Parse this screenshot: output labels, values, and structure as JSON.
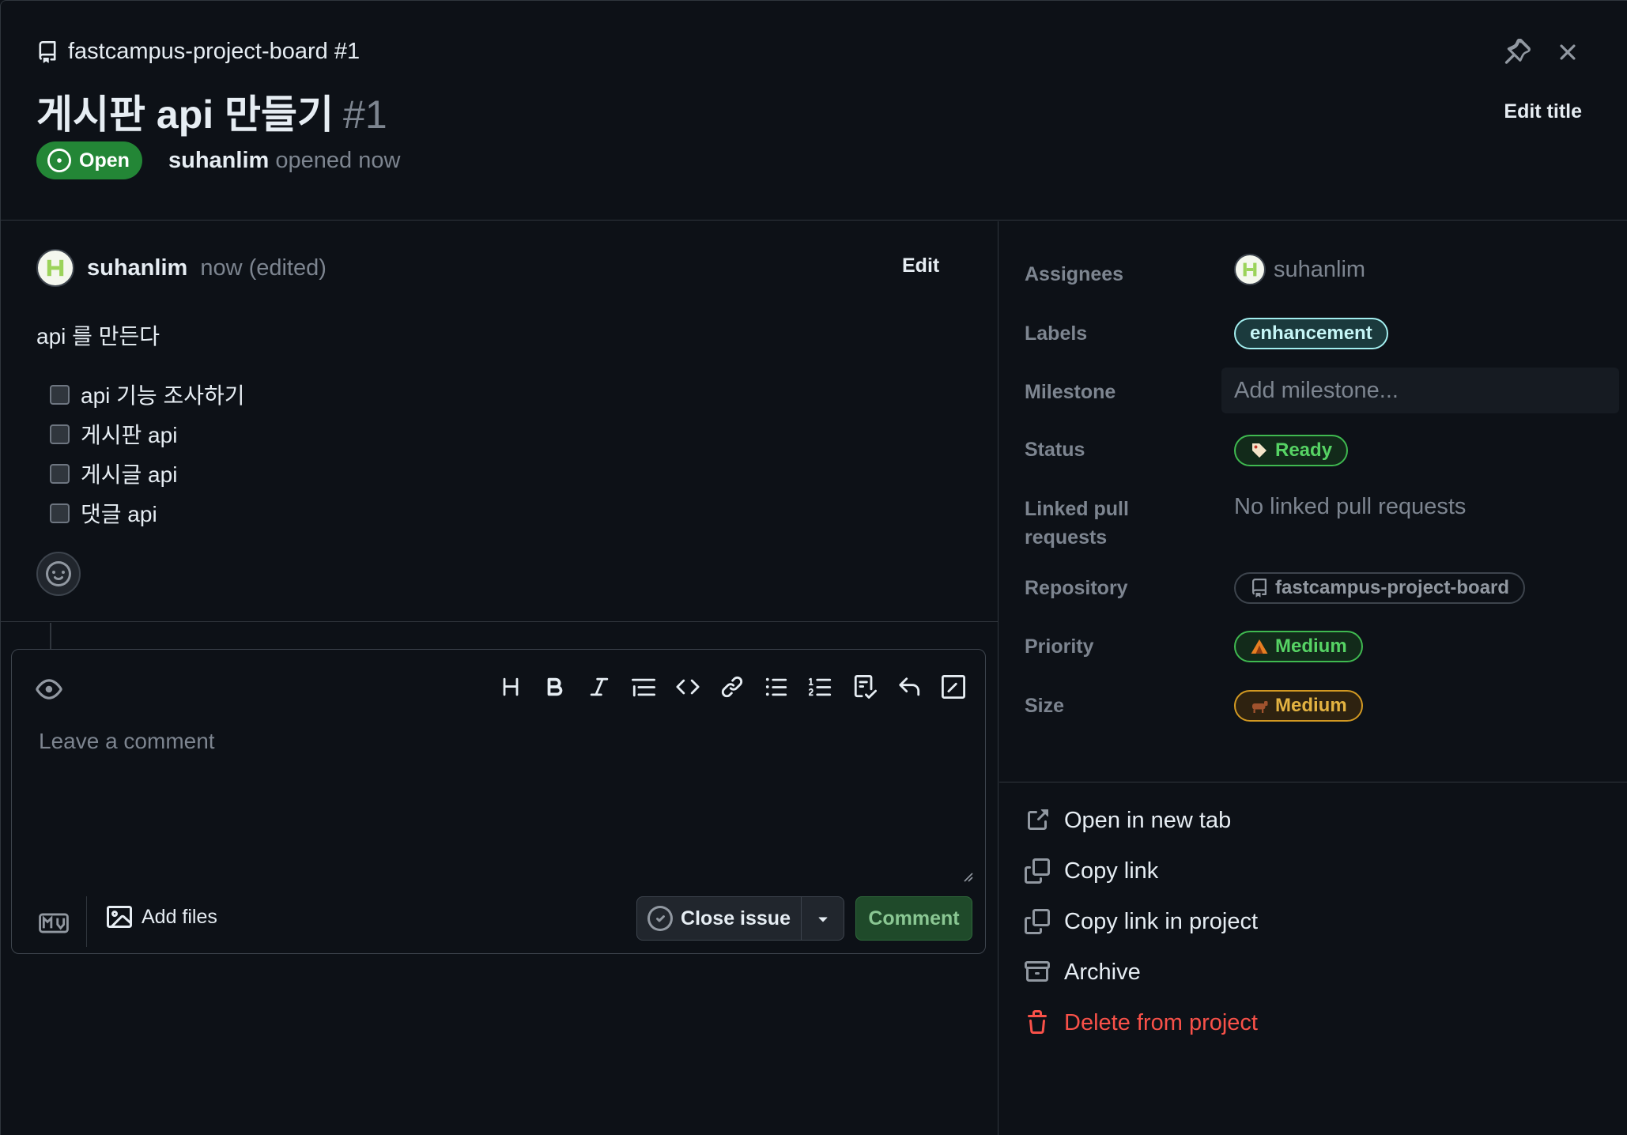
{
  "header": {
    "repo_label": "fastcampus-project-board #1",
    "title": "게시판 api 만들기",
    "number": "#1",
    "state": "Open",
    "opened_by": "suhanlim",
    "opened_when": "opened now",
    "edit_title_label": "Edit title"
  },
  "comment": {
    "author": "suhanlim",
    "time": "now (edited)",
    "edit_label": "Edit",
    "text": "api 를 만든다",
    "tasks": [
      {
        "label": "api 기능 조사하기",
        "checked": false
      },
      {
        "label": "게시판 api",
        "checked": false
      },
      {
        "label": "게시글 api",
        "checked": false
      },
      {
        "label": "댓글 api",
        "checked": false
      }
    ]
  },
  "composer": {
    "placeholder": "Leave a comment",
    "add_files_label": "Add files",
    "close_issue_label": "Close issue",
    "comment_label": "Comment",
    "toolbar_icons": [
      "heading-icon",
      "bold-icon",
      "italic-icon",
      "quote-icon",
      "code-icon",
      "link-icon",
      "unordered-list-icon",
      "ordered-list-icon",
      "task-list-icon",
      "reply-icon",
      "slash-commands-icon"
    ]
  },
  "fields": {
    "assignees_label": "Assignees",
    "assignee": "suhanlim",
    "labels_label": "Labels",
    "label_value": "enhancement",
    "milestone_label": "Milestone",
    "milestone_placeholder": "Add milestone...",
    "status_label": "Status",
    "status_value": "Ready",
    "linked_label_line1": "Linked pull",
    "linked_label_line2": "requests",
    "linked_value": "No linked pull requests",
    "repository_label": "Repository",
    "repository_value": "fastcampus-project-board",
    "priority_label": "Priority",
    "priority_value": "Medium",
    "size_label": "Size",
    "size_value": "Medium"
  },
  "actions": {
    "open_new_tab": "Open in new tab",
    "copy_link": "Copy link",
    "copy_link_project": "Copy link in project",
    "archive": "Archive",
    "delete": "Delete from project"
  },
  "colors": {
    "background": "#0d1117",
    "border": "#30363d",
    "open_green": "#238636",
    "danger": "#f85149",
    "muted": "#7d8590"
  }
}
